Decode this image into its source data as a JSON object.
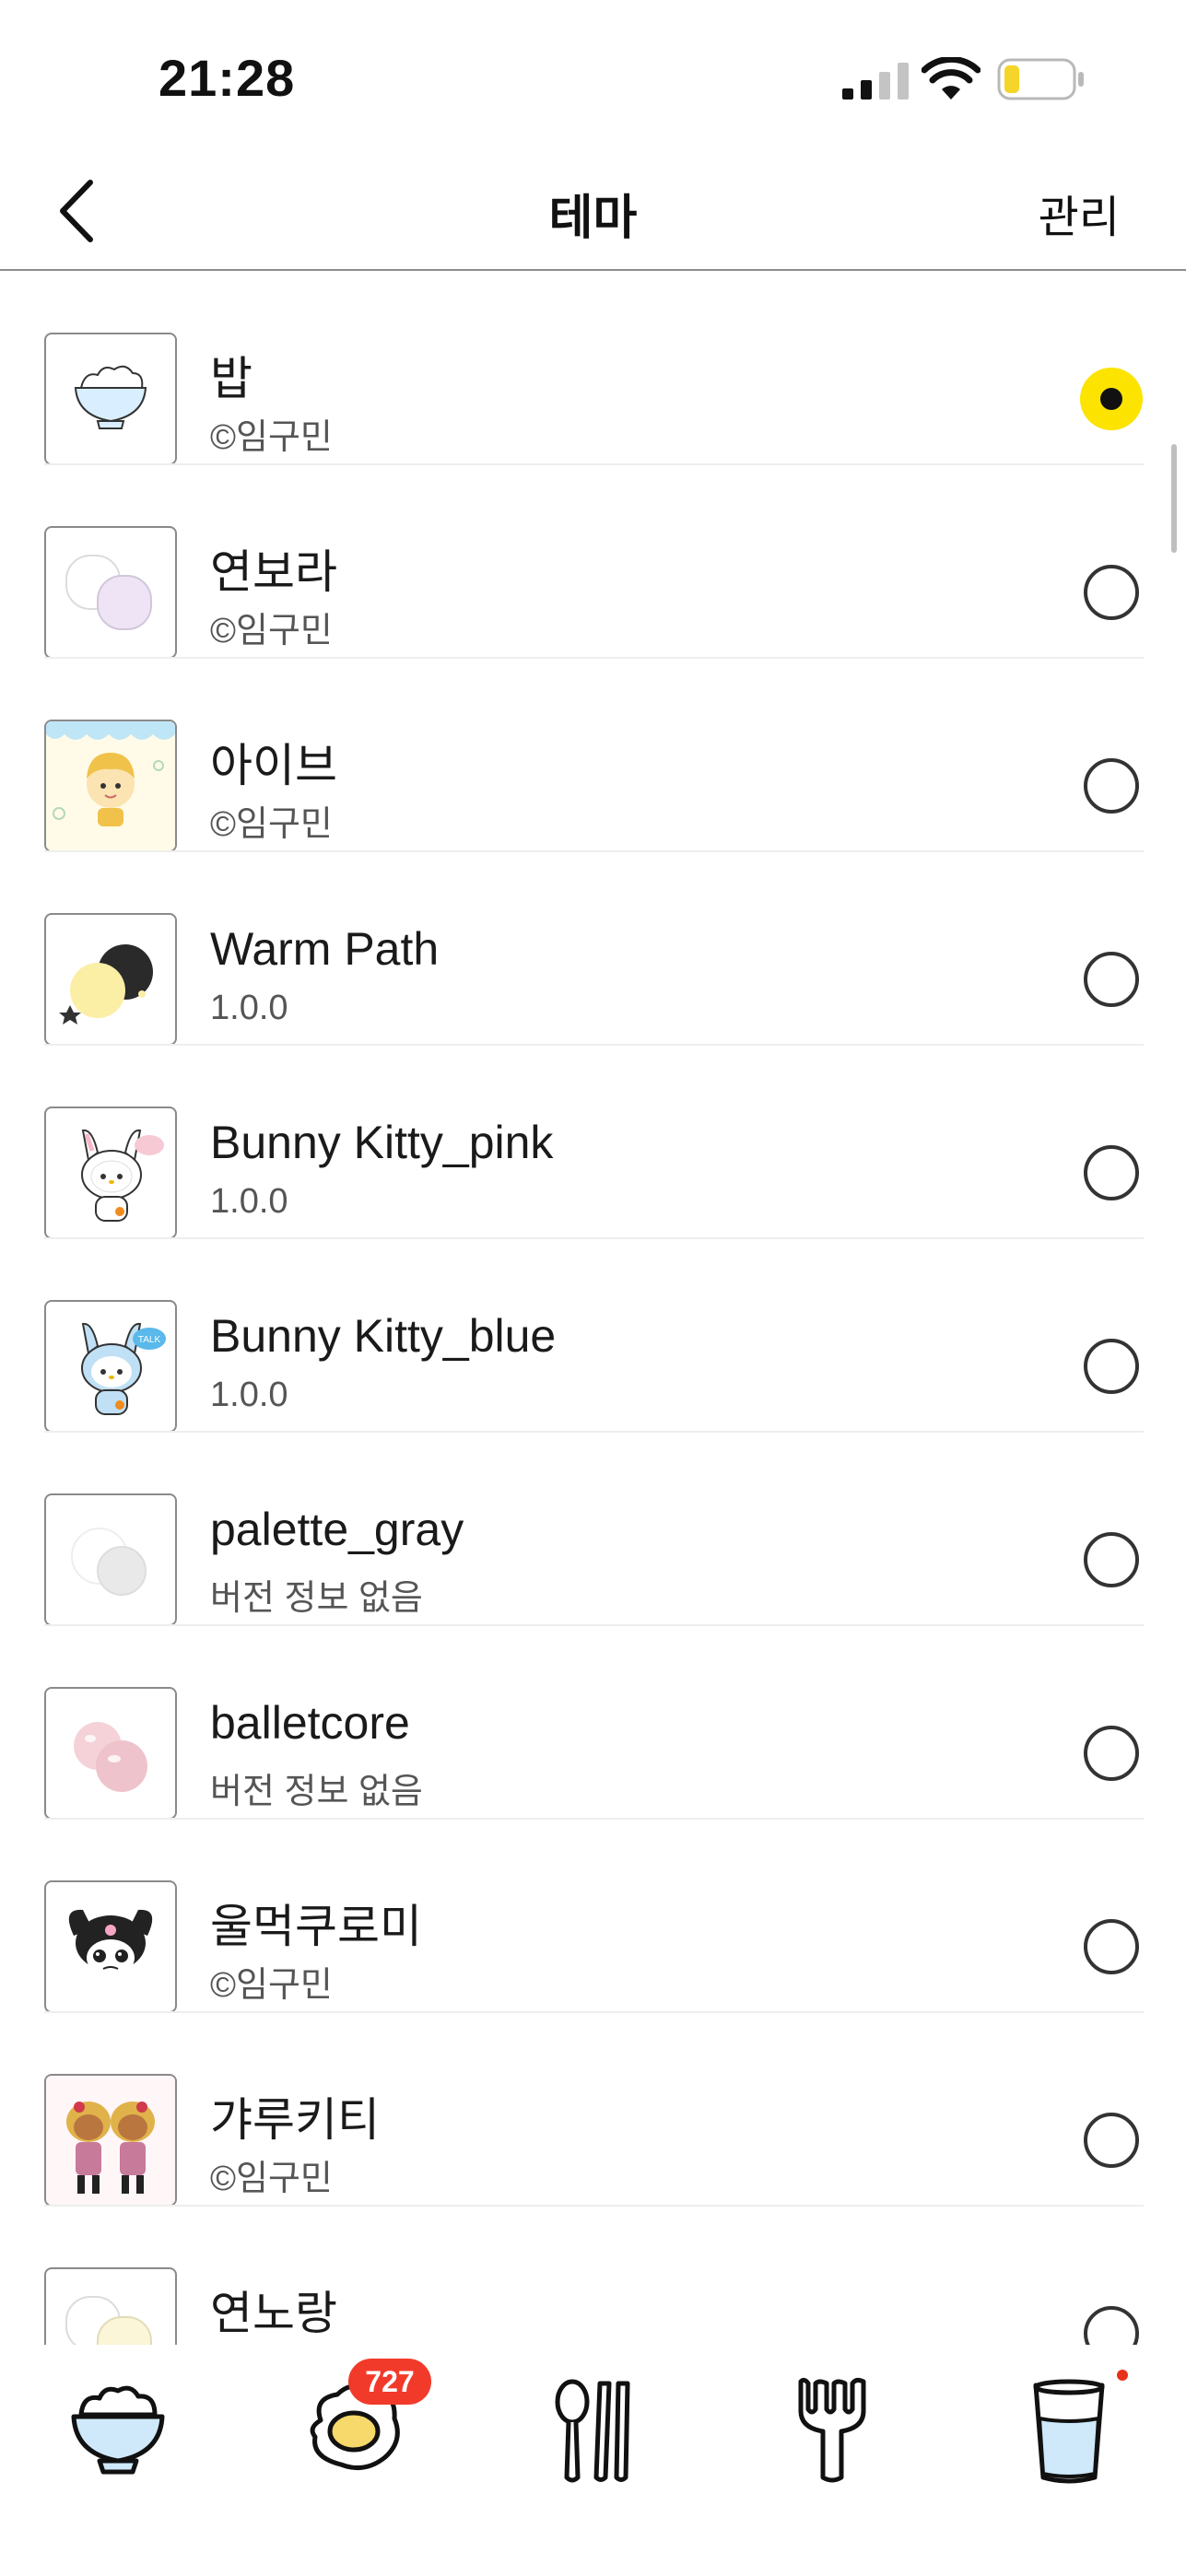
{
  "status_bar": {
    "time": "21:28"
  },
  "nav": {
    "title": "테마",
    "manage_label": "관리"
  },
  "themes": [
    {
      "name": "밥",
      "sub": "©임구민",
      "selected": true
    },
    {
      "name": "연보라",
      "sub": "©임구민",
      "selected": false
    },
    {
      "name": "아이브",
      "sub": "©임구민",
      "selected": false
    },
    {
      "name": "Warm Path",
      "sub": "1.0.0",
      "selected": false
    },
    {
      "name": "Bunny Kitty_pink",
      "sub": "1.0.0",
      "selected": false
    },
    {
      "name": "Bunny Kitty_blue",
      "sub": "1.0.0",
      "selected": false
    },
    {
      "name": "palette_gray",
      "sub": "버전 정보 없음",
      "selected": false
    },
    {
      "name": "balletcore",
      "sub": "버전 정보 없음",
      "selected": false
    },
    {
      "name": "울먹쿠로미",
      "sub": "©임구민",
      "selected": false
    },
    {
      "name": "갸루키티",
      "sub": "©임구민",
      "selected": false
    },
    {
      "name": "연노랑",
      "sub": "",
      "selected": false
    }
  ],
  "tabbar": {
    "tabs": [
      {
        "icon": "rice-bowl-icon"
      },
      {
        "icon": "fried-egg-icon"
      },
      {
        "icon": "spoon-chopsticks-icon"
      },
      {
        "icon": "fork-icon"
      },
      {
        "icon": "water-cup-icon"
      }
    ],
    "egg_badge": "727"
  },
  "colors": {
    "accent": "#fce300",
    "badge": "#f23a2a"
  }
}
